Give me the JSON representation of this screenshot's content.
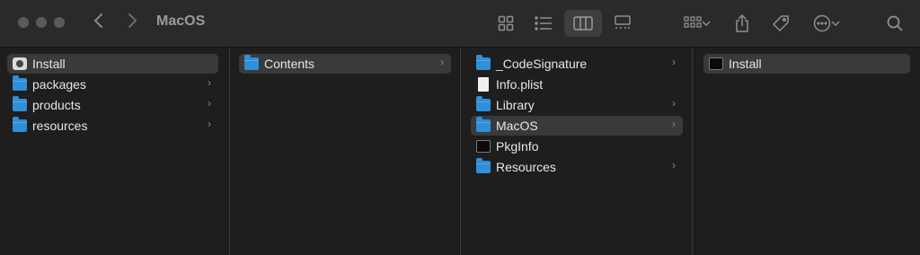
{
  "window": {
    "title": "MacOS"
  },
  "toolbar": {
    "back_icon": "chevron-left",
    "forward_icon": "chevron-right",
    "views": [
      "icon-view",
      "list-view",
      "column-view",
      "gallery-view"
    ],
    "active_view": "column-view",
    "actions": [
      "group-by",
      "share",
      "tags",
      "more-actions",
      "search"
    ]
  },
  "columns": [
    {
      "items": [
        {
          "label": "Install",
          "icon": "installer-icon",
          "selected": true,
          "has_children": false
        },
        {
          "label": "packages",
          "icon": "folder-icon",
          "selected": false,
          "has_children": true
        },
        {
          "label": "products",
          "icon": "folder-icon",
          "selected": false,
          "has_children": true
        },
        {
          "label": "resources",
          "icon": "folder-icon",
          "selected": false,
          "has_children": true
        }
      ]
    },
    {
      "items": [
        {
          "label": "Contents",
          "icon": "folder-icon",
          "selected": true,
          "has_children": true
        }
      ]
    },
    {
      "items": [
        {
          "label": "_CodeSignature",
          "icon": "folder-icon",
          "selected": false,
          "has_children": true
        },
        {
          "label": "Info.plist",
          "icon": "document-icon",
          "selected": false,
          "has_children": false
        },
        {
          "label": "Library",
          "icon": "folder-icon",
          "selected": false,
          "has_children": true
        },
        {
          "label": "MacOS",
          "icon": "folder-icon",
          "selected": true,
          "has_children": true
        },
        {
          "label": "PkgInfo",
          "icon": "executable-icon",
          "selected": false,
          "has_children": false
        },
        {
          "label": "Resources",
          "icon": "folder-icon",
          "selected": false,
          "has_children": true
        }
      ]
    },
    {
      "items": [
        {
          "label": "Install",
          "icon": "executable-icon",
          "selected": true,
          "has_children": false
        }
      ]
    }
  ],
  "colors": {
    "background": "#1e1e1e",
    "toolbar": "#2a2a2a",
    "selection": "#3a3a3a",
    "folder": "#2f8fd8",
    "text": "#e6e6e6"
  }
}
